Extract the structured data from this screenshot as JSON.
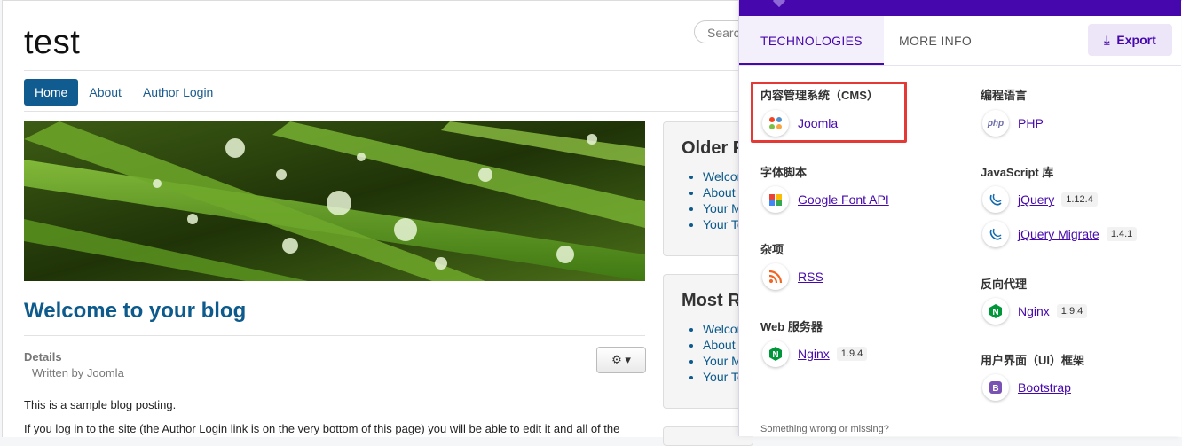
{
  "site": {
    "title": "test",
    "search_placeholder": "Search...",
    "nav": [
      {
        "label": "Home",
        "active": true
      },
      {
        "label": "About",
        "active": false
      },
      {
        "label": "Author Login",
        "active": false
      }
    ],
    "blog_title": "Welcome to your blog",
    "details_label": "Details",
    "written_by": "Written by Joomla",
    "gear_label": "⚙ ▾",
    "para1": "This is a sample blog posting.",
    "para2": "If you log in to the site (the Author Login link is on the very bottom of this page) you will be able to edit it and all of the",
    "modules": [
      {
        "title": "Older P",
        "items": [
          "Welcom",
          "About y",
          "Your M",
          "Your Te"
        ]
      },
      {
        "title": "Most Re",
        "items": [
          "Welcom",
          "About y",
          "Your M",
          "Your Te"
        ]
      }
    ]
  },
  "popup": {
    "tabs": [
      {
        "label": "TECHNOLOGIES",
        "active": true
      },
      {
        "label": "MORE INFO",
        "active": false
      }
    ],
    "export_label": "Export",
    "footer": "Something wrong or missing?",
    "left_column": [
      {
        "category": "内容管理系统（CMS）",
        "items": [
          {
            "name": "Joomla",
            "version": "",
            "icon": "joomla-icon"
          }
        ]
      },
      {
        "category": "字体脚本",
        "items": [
          {
            "name": "Google Font API",
            "version": "",
            "icon": "google-font-icon"
          }
        ]
      },
      {
        "category": "杂项",
        "items": [
          {
            "name": "RSS",
            "version": "",
            "icon": "rss-icon"
          }
        ]
      },
      {
        "category": "Web 服务器",
        "items": [
          {
            "name": "Nginx",
            "version": "1.9.4",
            "icon": "nginx-icon"
          }
        ]
      }
    ],
    "right_column": [
      {
        "category": "编程语言",
        "items": [
          {
            "name": "PHP",
            "version": "",
            "icon": "php-icon"
          }
        ]
      },
      {
        "category": "JavaScript 库",
        "items": [
          {
            "name": "jQuery",
            "version": "1.12.4",
            "icon": "jquery-icon"
          },
          {
            "name": "jQuery Migrate",
            "version": "1.4.1",
            "icon": "jquery-migrate-icon"
          }
        ]
      },
      {
        "category": "反向代理",
        "items": [
          {
            "name": "Nginx",
            "version": "1.9.4",
            "icon": "nginx-icon"
          }
        ]
      },
      {
        "category": "用户界面（UI）框架",
        "items": [
          {
            "name": "Bootstrap",
            "version": "",
            "icon": "bootstrap-icon"
          }
        ]
      }
    ]
  },
  "colors": {
    "brand": "#4608ad",
    "site_link": "#0d5a8c",
    "highlight": "#e53935"
  }
}
